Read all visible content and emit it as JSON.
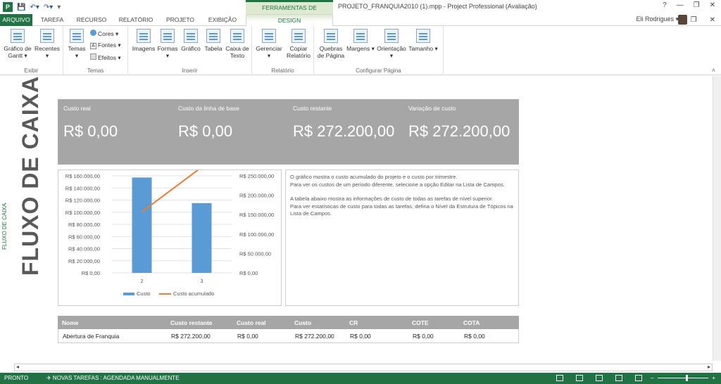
{
  "window": {
    "title": "PROJETO_FRANQUIA2010 (1).mpp - Project Professional (Avaliação)",
    "context_tab_header": "FERRAMENTAS DE RELATÓRIO",
    "user_name": "Eli Rodrigues ▾",
    "controls": [
      "?",
      "—",
      "❐",
      "✕"
    ],
    "ribbon_controls": [
      "❐",
      "✕"
    ]
  },
  "tabs": [
    "ARQUIVO",
    "TAREFA",
    "RECURSO",
    "RELATÓRIO",
    "PROJETO",
    "EXIBIÇÃO",
    "DESIGN"
  ],
  "ribbon": {
    "groups": [
      {
        "label": "Exibir",
        "buttons": [
          "Gráfico de Gantt ▾",
          "Recentes ▾"
        ]
      },
      {
        "label": "Temas",
        "buttons": [
          "Temas ▾"
        ],
        "small": [
          "Cores ▾",
          "Fontes ▾",
          "Efeitos ▾"
        ]
      },
      {
        "label": "Inserir",
        "buttons": [
          "Imagens",
          "Formas ▾",
          "Gráfico",
          "Tabela",
          "Caixa de Texto"
        ]
      },
      {
        "label": "Relatório",
        "buttons": [
          "Gerenciar ▾",
          "Copiar Relatório"
        ]
      },
      {
        "label": "Configurar Página",
        "buttons": [
          "Quebras de Página",
          "Margens ▾",
          "Orientação ▾",
          "Tamanho ▾"
        ]
      }
    ]
  },
  "report": {
    "side_label": "FLUXO DE CAIXA",
    "title": "FLUXO DE CAIXA",
    "kpis": [
      {
        "label": "Custo real",
        "value": "R$ 0,00"
      },
      {
        "label": "Custo da linha de base",
        "value": "R$ 0,00"
      },
      {
        "label": "Custo restante",
        "value": "R$ 272.200,00"
      },
      {
        "label": "Variação de custo",
        "value": "R$ 272.200,00"
      }
    ],
    "description": [
      "O gráfico mostra o custo acumulado do projeto e o custo por trimestre.",
      "Para ver os custos de um período diferente, selecione a opção Editar na Lista de Campos.",
      "A tabela abaixo mostra as informações de custo de todas as tarefas de nível superior.",
      "Para ver estatísticas de custo para todas as tarefas, defina o Nível da Estrutura de Tópicos na Lista de Campos."
    ],
    "table": {
      "headers": [
        "Nome",
        "Custo restante",
        "Custo real",
        "Custo",
        "CR",
        "COTE",
        "COTA"
      ],
      "rows": [
        [
          "Abertura de Franquia",
          "R$ 272.200,00",
          "R$ 0,00",
          "R$ 272.200,00",
          "R$ 0,00",
          "R$ 0,00",
          "R$ 0,00"
        ]
      ]
    }
  },
  "chart_data": {
    "type": "bar",
    "categories": [
      "2",
      "3"
    ],
    "series": [
      {
        "name": "Custo",
        "type": "bar",
        "axis": "left",
        "color": "#5b9bd5",
        "values": [
          157200,
          115000
        ]
      },
      {
        "name": "Custo acumulado",
        "type": "line",
        "axis": "right",
        "color": "#ed7d31",
        "values": [
          157200,
          272200
        ]
      }
    ],
    "ylim_left": [
      0,
      160000
    ],
    "ylim_right": [
      0,
      250000
    ],
    "left_ticks": [
      "R$ 0,00",
      "R$ 20.000,00",
      "R$ 40.000,00",
      "R$ 60.000,00",
      "R$ 80.000,00",
      "R$ 100.000,00",
      "R$ 120.000,00",
      "R$ 140.000,00",
      "R$ 160.000,00"
    ],
    "right_ticks": [
      "R$ 0,00",
      "R$ 50.000,00",
      "R$ 100.000,00",
      "R$ 150.000,00",
      "R$ 200.000,00",
      "R$ 250.000,00"
    ],
    "legend_position": "bottom",
    "grid": true
  },
  "status": {
    "mode": "PRONTO",
    "new_tasks": "✈ NOVAS TAREFAS : AGENDADA MANUALMENTE",
    "zoom_minus": "−",
    "zoom_plus": "+"
  },
  "colors": {
    "accent": "#217346",
    "panel": "#a6a6a6",
    "bar": "#5b9bd5",
    "line": "#ed7d31"
  }
}
